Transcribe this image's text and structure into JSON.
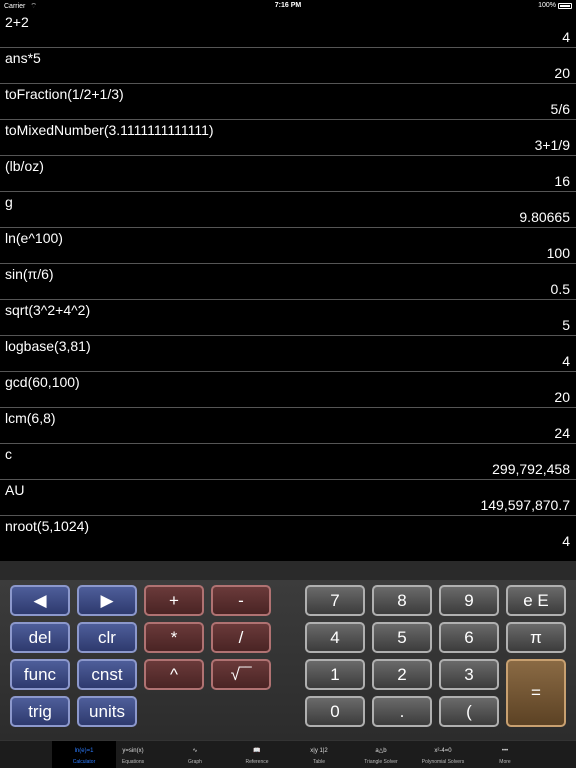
{
  "status": {
    "carrier": "Carrier",
    "time": "7:16 PM",
    "battery": "100%"
  },
  "history": [
    {
      "expr": "2+2",
      "result": "4"
    },
    {
      "expr": "ans*5",
      "result": "20"
    },
    {
      "expr": "toFraction(1/2+1/3)",
      "result": "5/6"
    },
    {
      "expr": "toMixedNumber(3.1111111111111)",
      "result": "3+1/9"
    },
    {
      "expr": "(lb/oz)",
      "result": "16"
    },
    {
      "expr": "g",
      "result": "9.80665"
    },
    {
      "expr": "ln(e^100)",
      "result": "100"
    },
    {
      "expr": "sin(π/6)",
      "result": "0.5"
    },
    {
      "expr": "sqrt(3^2+4^2)",
      "result": "5"
    },
    {
      "expr": "logbase(3,81)",
      "result": "4"
    },
    {
      "expr": "gcd(60,100)",
      "result": "20"
    },
    {
      "expr": "lcm(6,8)",
      "result": "24"
    },
    {
      "expr": "c",
      "result": "299,792,458"
    },
    {
      "expr": "AU",
      "result": "149,597,870.7"
    },
    {
      "expr": "nroot(5,1024)",
      "result": "4"
    }
  ],
  "keys": {
    "left": "◀",
    "right": "▶",
    "plus": "+",
    "minus": "-",
    "del": "del",
    "clr": "clr",
    "multiply": "*",
    "divide": "/",
    "func": "func",
    "cnst": "cnst",
    "power": "^",
    "sqrt": "√‾‾",
    "trig": "trig",
    "units": "units",
    "n7": "7",
    "n8": "8",
    "n9": "9",
    "eE": "e E",
    "n4": "4",
    "n5": "5",
    "n6": "6",
    "pi": "π",
    "n1": "1",
    "n2": "2",
    "n3": "3",
    "n0": "0",
    "dot": ".",
    "paren": "(",
    "equals": "="
  },
  "tabs": [
    {
      "icon": "ln(e)=1",
      "label": "Calculator"
    },
    {
      "icon": "y=sin(x)",
      "label": "Equations"
    },
    {
      "icon": "∿",
      "label": "Graph"
    },
    {
      "icon": "📖",
      "label": "Reference"
    },
    {
      "icon": "x|y 1|2",
      "label": "Table"
    },
    {
      "icon": "a△b",
      "label": "Triangle Solver"
    },
    {
      "icon": "x²-4=0",
      "label": "Polynomial Solvers"
    },
    {
      "icon": "•••",
      "label": "More"
    }
  ]
}
